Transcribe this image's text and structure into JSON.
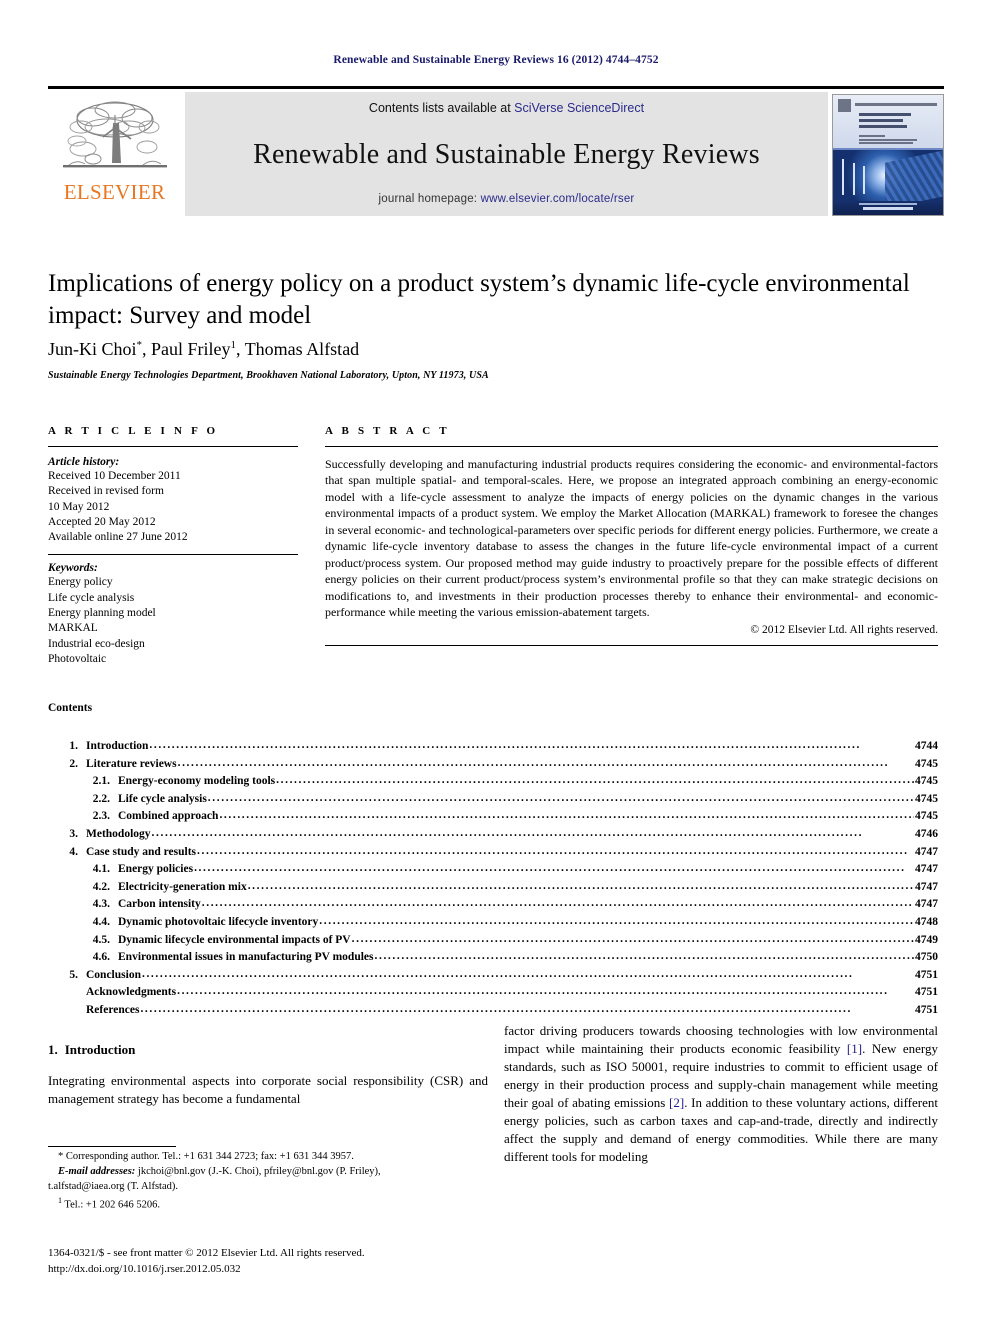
{
  "running_head": "Renewable and Sustainable Energy Reviews 16 (2012) 4744–4752",
  "masthead": {
    "publisher_name": "ELSEVIER",
    "contents_prefix": "Contents lists available at ",
    "contents_link": "SciVerse ScienceDirect",
    "journal_title": "Renewable and Sustainable Energy Reviews",
    "homepage_prefix": "journal homepage: ",
    "homepage_url": "www.elsevier.com/locate/rser",
    "link_color": "#2b2b8c",
    "brand_color": "#E87722"
  },
  "article": {
    "title": "Implications of energy policy on a product system’s dynamic life-cycle environmental impact: Survey and model",
    "authors_html": "Jun-Ki Choi*, Paul Friley 1, Thomas Alfstad",
    "affiliation": "Sustainable Energy Technologies Department, Brookhaven National Laboratory, Upton, NY 11973, USA"
  },
  "article_info": {
    "heading": "A R T I C L E   I N F O",
    "history_label": "Article history:",
    "history": [
      "Received 10 December 2011",
      "Received in revised form",
      "10 May 2012",
      "Accepted 20 May 2012",
      "Available online 27 June 2012"
    ],
    "keywords_label": "Keywords:",
    "keywords": [
      "Energy policy",
      "Life cycle analysis",
      "Energy planning model",
      "MARKAL",
      "Industrial eco-design",
      "Photovoltaic"
    ]
  },
  "abstract": {
    "heading": "A B S T R A C T",
    "text": "Successfully developing and manufacturing industrial products requires considering the economic- and environmental-factors that span multiple spatial- and temporal-scales. Here, we propose an integrated approach combining an energy-economic model with a life-cycle assessment to analyze the impacts of energy policies on the dynamic changes in the various environmental impacts of a product system. We employ the Market Allocation (MARKAL) framework to foresee the changes in several economic- and technological-parameters over specific periods for different energy policies. Furthermore, we create a dynamic life-cycle inventory database to assess the changes in the future life-cycle environmental impact of a current product/process system. Our proposed method may guide industry to proactively prepare for the possible effects of different energy policies on their current product/process system’s environmental profile so that they can make strategic decisions on modifications to, and investments in their production processes thereby to enhance their environmental- and economic-performance while meeting the various emission-abatement targets.",
    "copyright": "© 2012 Elsevier Ltd. All rights reserved."
  },
  "contents": {
    "heading": "Contents",
    "entries": [
      {
        "level": 1,
        "num": "1.",
        "label": "Introduction",
        "page": "4744"
      },
      {
        "level": 1,
        "num": "2.",
        "label": "Literature reviews",
        "page": "4745"
      },
      {
        "level": 2,
        "num": "2.1.",
        "label": "Energy-economy modeling tools",
        "page": "4745"
      },
      {
        "level": 2,
        "num": "2.2.",
        "label": "Life cycle analysis",
        "page": "4745"
      },
      {
        "level": 2,
        "num": "2.3.",
        "label": "Combined approach",
        "page": "4745"
      },
      {
        "level": 1,
        "num": "3.",
        "label": "Methodology",
        "page": "4746"
      },
      {
        "level": 1,
        "num": "4.",
        "label": "Case study and results",
        "page": "4747"
      },
      {
        "level": 2,
        "num": "4.1.",
        "label": "Energy policies",
        "page": "4747"
      },
      {
        "level": 2,
        "num": "4.2.",
        "label": "Electricity-generation mix",
        "page": "4747"
      },
      {
        "level": 2,
        "num": "4.3.",
        "label": "Carbon intensity",
        "page": "4747"
      },
      {
        "level": 2,
        "num": "4.4.",
        "label": "Dynamic photovoltaic lifecycle inventory",
        "page": "4748"
      },
      {
        "level": 2,
        "num": "4.5.",
        "label": "Dynamic lifecycle environmental impacts of PV",
        "page": "4749"
      },
      {
        "level": 2,
        "num": "4.6.",
        "label": "Environmental issues in manufacturing PV modules",
        "page": "4750"
      },
      {
        "level": 1,
        "num": "5.",
        "label": "Conclusion",
        "page": "4751"
      },
      {
        "level": 0,
        "num": "",
        "label": "Acknowledgments",
        "page": "4751"
      },
      {
        "level": 0,
        "num": "",
        "label": "References",
        "page": "4751"
      }
    ]
  },
  "introduction": {
    "number": "1.",
    "heading": "Introduction",
    "left_paragraph": "Integrating environmental aspects into corporate social responsibility (CSR) and management strategy has become a fundamental",
    "right_part_a": "factor driving producers towards choosing technologies with low environmental impact while maintaining their products economic feasibility ",
    "right_ref_1": "[1]",
    "right_part_b": ". New energy standards, such as ISO 50001, require industries to commit to efficient usage of energy in their production process and supply-chain management while meeting their goal of abating emissions ",
    "right_ref_2": "[2]",
    "right_part_c": ". In addition to these voluntary actions, different energy policies, such as carbon taxes and cap-and-trade, directly and indirectly affect the supply and demand of energy commodities. While there are many different tools for modeling"
  },
  "footnotes": {
    "corresponding": "* Corresponding author. Tel.: +1 631 344 2723; fax: +1 631 344 3957.",
    "emails_label": "E-mail addresses:",
    "emails_text": " jkchoi@bnl.gov (J.-K. Choi), pfriley@bnl.gov (P. Friley),",
    "emails_text2": "t.alfstad@iaea.org (T. Alfstad).",
    "tel_sup": "1",
    "tel_text": " Tel.: +1 202 646 5206."
  },
  "imprint": {
    "line1": "1364-0321/$ - see front matter © 2012 Elsevier Ltd. All rights reserved.",
    "line2": "http://dx.doi.org/10.1016/j.rser.2012.05.032"
  }
}
